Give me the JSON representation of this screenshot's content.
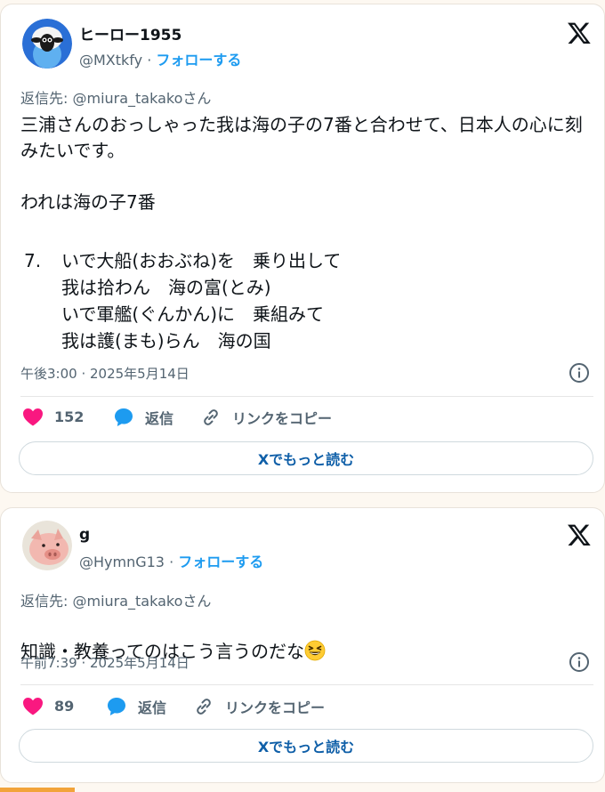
{
  "tweets": [
    {
      "display_name": "ヒーロー1955",
      "handle": "@MXtkfy",
      "separator": " · ",
      "follow_label": "フォローする",
      "reply_to": "返信先: @miura_takakoさん",
      "body": "三浦さんのおっしゃった我は海の子の7番と合わせて、日本人の心に刻みたいです。\n\nわれは海の子7番",
      "verse_number": "7.",
      "verse_lines": [
        "いで大船(おおぶね)を　乗り出して",
        "我は拾わん　海の富(とみ)",
        "いで軍艦(ぐんかん)に　乗組みて",
        "我は護(まも)らん　海の国"
      ],
      "timestamp": "午後3:00 · 2025年5月14日",
      "likes": "152",
      "reply_label": "返信",
      "copy_link_label": "リンクをコピー",
      "read_more_label": "Xでもっと読む"
    },
    {
      "display_name": "g",
      "handle": "@HymnG13",
      "separator": " · ",
      "follow_label": "フォローする",
      "reply_to": "返信先: @miura_takakoさん",
      "body": "知識・教養ってのはこう言うのだな",
      "emoji": "grinning-squinting-face",
      "timestamp": "午前7:39 · 2025年5月14日",
      "likes": "89",
      "reply_label": "返信",
      "copy_link_label": "リンクをコピー",
      "read_more_label": "Xでもっと読む"
    }
  ],
  "colors": {
    "accent": "#1d9bf0",
    "like": "#f91880",
    "text": "#0f1419",
    "muted": "#536471",
    "read_more_text": "#0f5fa8"
  }
}
